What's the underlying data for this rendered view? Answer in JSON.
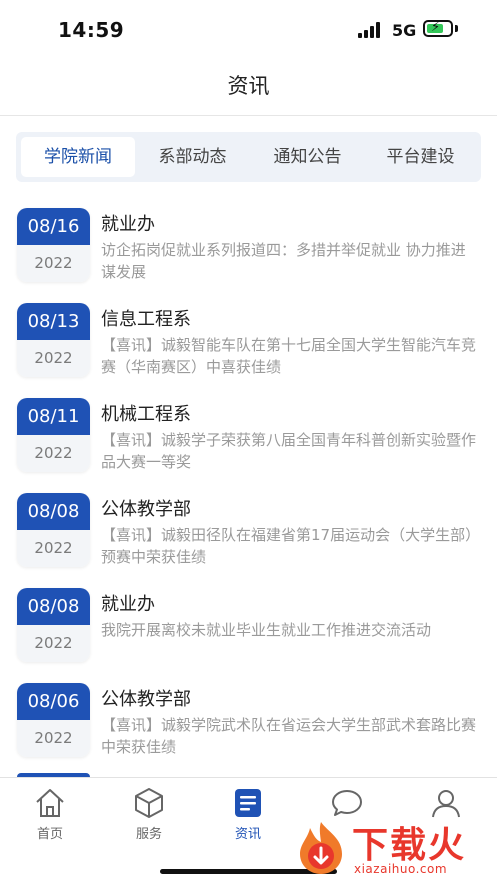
{
  "status_bar": {
    "time": "14:59",
    "network": "5G"
  },
  "header": {
    "title": "资讯"
  },
  "tabs": [
    {
      "label": "学院新闻",
      "active": true
    },
    {
      "label": "系部动态",
      "active": false
    },
    {
      "label": "通知公告",
      "active": false
    },
    {
      "label": "平台建设",
      "active": false
    }
  ],
  "news": [
    {
      "month_day": "08/16",
      "year": "2022",
      "department": "就业办",
      "summary": "访企拓岗促就业系列报道四：多措并举促就业 协力推进谋发展"
    },
    {
      "month_day": "08/13",
      "year": "2022",
      "department": "信息工程系",
      "summary": "【喜讯】诚毅智能车队在第十七届全国大学生智能汽车竞赛（华南赛区）中喜获佳绩"
    },
    {
      "month_day": "08/11",
      "year": "2022",
      "department": "机械工程系",
      "summary": "【喜讯】诚毅学子荣获第八届全国青年科普创新实验暨作品大赛一等奖"
    },
    {
      "month_day": "08/08",
      "year": "2022",
      "department": "公体教学部",
      "summary": "【喜讯】诚毅田径队在福建省第17届运动会（大学生部）预赛中荣获佳绩"
    },
    {
      "month_day": "08/08",
      "year": "2022",
      "department": "就业办",
      "summary": "我院开展离校未就业毕业生就业工作推进交流活动"
    },
    {
      "month_day": "08/06",
      "year": "2022",
      "department": "公体教学部",
      "summary": "【喜讯】诚毅学院武术队在省运会大学生部武术套路比赛中荣获佳绩"
    }
  ],
  "tab_bar": [
    {
      "label": "首页",
      "icon": "home-icon",
      "active": false
    },
    {
      "label": "服务",
      "icon": "cube-icon",
      "active": false
    },
    {
      "label": "资讯",
      "icon": "document-icon",
      "active": true
    },
    {
      "label": "",
      "icon": "chat-icon",
      "active": false
    },
    {
      "label": "",
      "icon": "user-icon",
      "active": false
    }
  ],
  "watermark": {
    "brand": "下载火",
    "url": "xiazaihuo.com"
  },
  "colors": {
    "accent": "#1f52b5",
    "tab_background": "#eef2f8",
    "muted_text": "#9a9a9a",
    "watermark": "#e8372c"
  }
}
